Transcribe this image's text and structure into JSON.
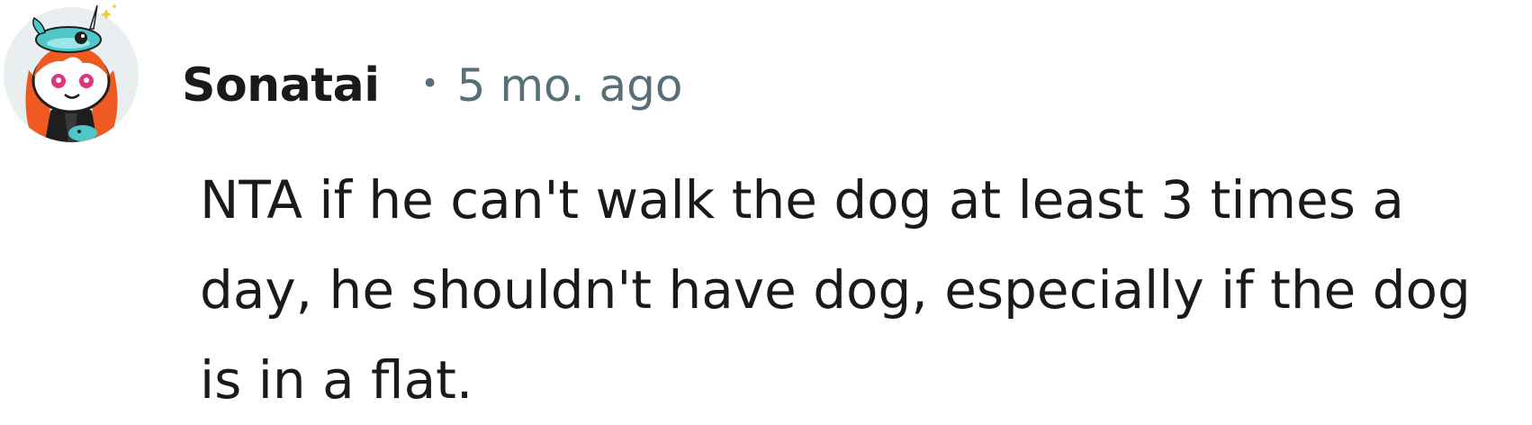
{
  "comment": {
    "author": "Sonatai",
    "separator": "•",
    "timestamp": "5 mo. ago",
    "avatar_icon": "reddit-snoo-avatar-icon",
    "text": "NTA if he can't walk the dog at least 3 times a day, he shouldn't have dog, especially if the dog is in a flat."
  },
  "colors": {
    "author_text": "#1a1a1b",
    "meta_text": "#576f76",
    "body_text": "#1a1a1b",
    "avatar_background": "#e9eef0",
    "avatar_hair": "#ee5a1f",
    "avatar_hat": "#4fc7c8"
  }
}
